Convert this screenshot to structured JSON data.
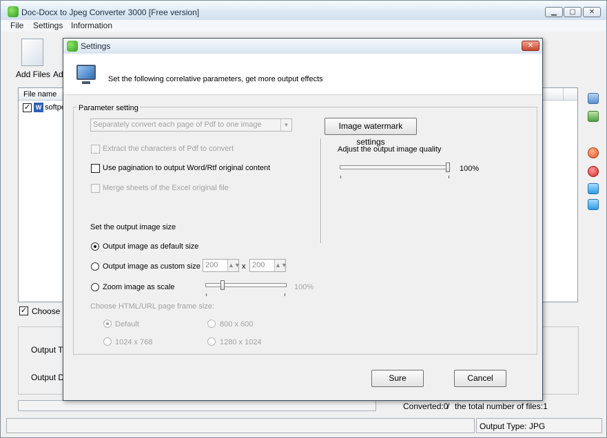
{
  "window": {
    "title": "Doc-Docx to Jpeg Converter 3000 [Free version]",
    "min_glyph": "▁",
    "max_glyph": "▢",
    "close_glyph": "✕"
  },
  "menu": {
    "file": "File",
    "settings": "Settings",
    "information": "Information"
  },
  "toolbar": {
    "add_files": "Add Files",
    "add_folder_partial": "Ad"
  },
  "file_list": {
    "header_file_name": "File name",
    "rows": [
      {
        "name": "softpe",
        "checked": true
      }
    ]
  },
  "main_options": {
    "choose_partial": "Choose a",
    "output_type_partial": "Output Ty",
    "output_dir_partial": "Output Di"
  },
  "status": {
    "converted": "Converted:0",
    "separator": "/",
    "total": "the total number of files:1",
    "output_type": "Output Type: JPG"
  },
  "dialog": {
    "title": "Settings",
    "close_glyph": "✕",
    "banner_text": "Set the following correlative parameters, get more output effects",
    "group_title": "Parameter setting",
    "pdf_mode_combo": "Separately convert each page of Pdf to one image",
    "watermark_button": "Image watermark settings",
    "quality_label": "Adjust the output image quality",
    "quality_percent": "100%",
    "extract_chars": "Extract the characters of Pdf to convert",
    "use_pagination": "Use pagination to output Word/Rtf original content",
    "merge_sheets": "Merge sheets of the Excel original file",
    "size_label": "Set the output image size",
    "default_size": "Output image as default size",
    "custom_size": "Output image as custom size",
    "width_value": "200",
    "times": "x",
    "height_value": "200",
    "zoom_scale": "Zoom image as scale",
    "zoom_percent": "100%",
    "frame_label": "Choose HTML/URL page frame size:",
    "frame_default": "Default",
    "frame_800": "800 x 600",
    "frame_1024": "1024 x 768",
    "frame_1280": "1280 x 1024",
    "sure_button": "Sure",
    "cancel_button": "Cancel",
    "quality_level": 1.0,
    "zoom_level": 0.2
  },
  "colors": {
    "accent_green": "#2e9d1c",
    "close_red": "#c6462f"
  }
}
